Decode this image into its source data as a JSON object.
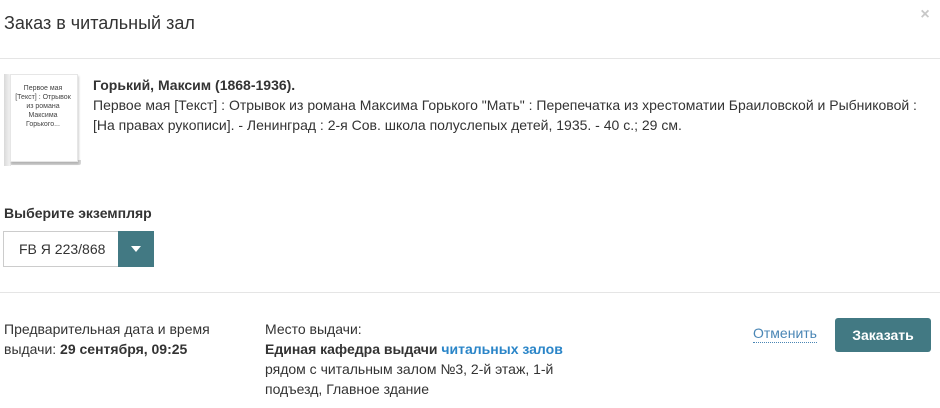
{
  "dialog": {
    "title": "Заказ в читальный зал",
    "close_label": "×"
  },
  "book": {
    "cover_text": "Первое мая [Текст] : Отрывок из романа Максима Горького...",
    "author": "Горький, Максим (1868-1936).",
    "description": "Первое мая [Текст] : Отрывок из романа Максима Горького \"Мать\" : Перепечатка из хрестоматии Браиловской и Рыбниковой : [На правах рукописи]. - Ленинград : 2-я Сов. школа полуслепых детей, 1935. - 40 с.; 29 см."
  },
  "copy_select": {
    "label": "Выберите экземпляр",
    "selected": "FB Я 223/868"
  },
  "schedule": {
    "label": "Предварительная дата и время выдачи:",
    "value": "29 сентября, 09:25"
  },
  "pickup": {
    "label": "Место выдачи:",
    "name_bold": "Единая кафедра выдачи",
    "name_link": "читальных залов",
    "address": "рядом с читальным залом №3, 2-й этаж, 1-й подъезд, Главное здание"
  },
  "actions": {
    "cancel_label": "Отменить",
    "order_label": "Заказать"
  },
  "colors": {
    "accent": "#427983",
    "link": "#2a85c8",
    "cancel_link": "#4a86b5"
  },
  "icons": {
    "close": "close-icon",
    "dropdown": "chevron-down-icon"
  }
}
